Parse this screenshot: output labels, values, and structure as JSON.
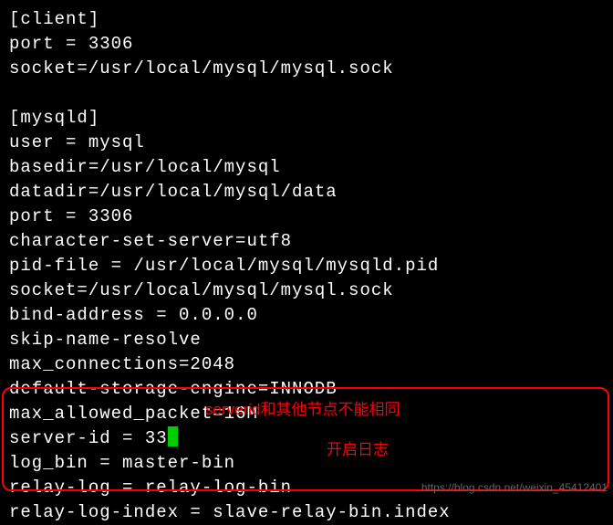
{
  "lines": {
    "l0": "[client]",
    "l1": "port = 3306",
    "l2": "socket=/usr/local/mysql/mysql.sock",
    "l3": "",
    "l4": "[mysqld]",
    "l5": "user = mysql",
    "l6": "basedir=/usr/local/mysql",
    "l7": "datadir=/usr/local/mysql/data",
    "l8": "port = 3306",
    "l9": "character-set-server=utf8",
    "l10": "pid-file = /usr/local/mysql/mysqld.pid",
    "l11": "socket=/usr/local/mysql/mysql.sock",
    "l12": "bind-address = 0.0.0.0",
    "l13": "skip-name-resolve",
    "l14": "max_connections=2048",
    "l15": "default-storage-engine=INNODB",
    "l16": "max_allowed_packet=16M",
    "l17": "server-id = 33",
    "l18": "log_bin = master-bin",
    "l19": "relay-log = relay-log-bin",
    "l20": "relay-log-index = slave-relay-bin.index"
  },
  "annotations": {
    "note1": "serverid和其他节点不能相同",
    "note2": "开启日志"
  },
  "watermark": "https://blog.csdn.net/weixin_45412401"
}
